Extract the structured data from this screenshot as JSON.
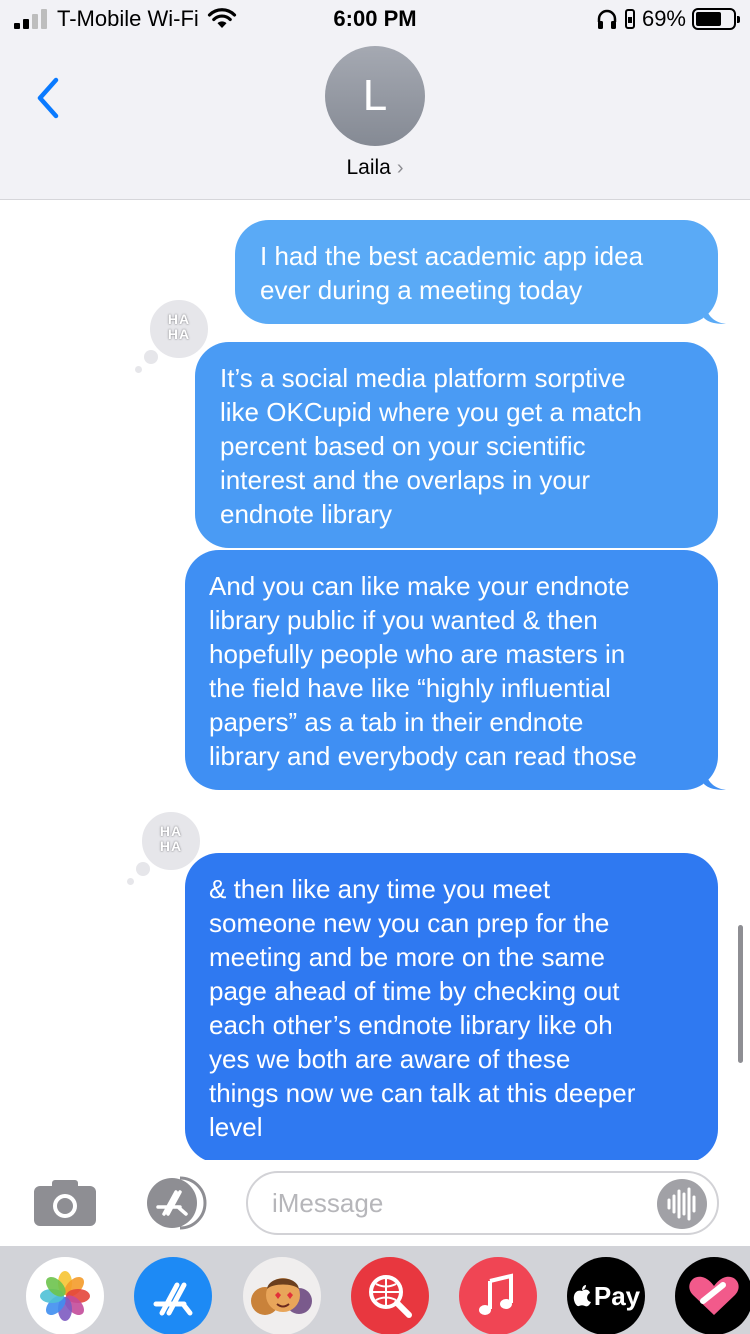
{
  "status_bar": {
    "carrier": "T-Mobile Wi-Fi",
    "time": "6:00 PM",
    "battery_percent": "69%",
    "battery_level": 0.69
  },
  "header": {
    "avatar_initial": "L",
    "contact_name": "Laila",
    "chevron": "›"
  },
  "messages": [
    {
      "sender": "me",
      "text": "I had the best academic app idea\never during a meeting today",
      "reaction": "haha"
    },
    {
      "sender": "me",
      "text": "It’s a social media platform sorptive\nlike OKCupid where you get a match\npercent based on your scientific\ninterest and the overlaps in your\nendnote library",
      "reaction": null
    },
    {
      "sender": "me",
      "text": "And you can like make your endnote\nlibrary public if you wanted & then\nhopefully people who are masters in\nthe field have like “highly influential\npapers” as a tab in their endnote\nlibrary and everybody can read those",
      "reaction": "haha"
    },
    {
      "sender": "me",
      "text": "& then like any time you meet\nsomeone new you can prep for the\nmeeting and be more on the same\npage ahead of time by checking out\neach other’s endnote library like oh\nyes we both are aware of these\nthings now we can talk at this deeper\nlevel",
      "reaction": null
    }
  ],
  "tapback_label": "HA\nHA",
  "input_bar": {
    "placeholder": "iMessage"
  },
  "app_drawer": {
    "apps": [
      "photos-icon",
      "app-store-icon",
      "memoji-icon",
      "search-images-icon",
      "music-icon",
      "apple-pay-icon",
      "digital-touch-icon"
    ],
    "apple_pay_label": "Pay"
  },
  "colors": {
    "bubble_1": "#5aaaf6",
    "bubble_2": "#4a9bf4",
    "bubble_3": "#3f8ff3",
    "bubble_4": "#2f79f1",
    "ios_blue": "#0a7aff"
  }
}
